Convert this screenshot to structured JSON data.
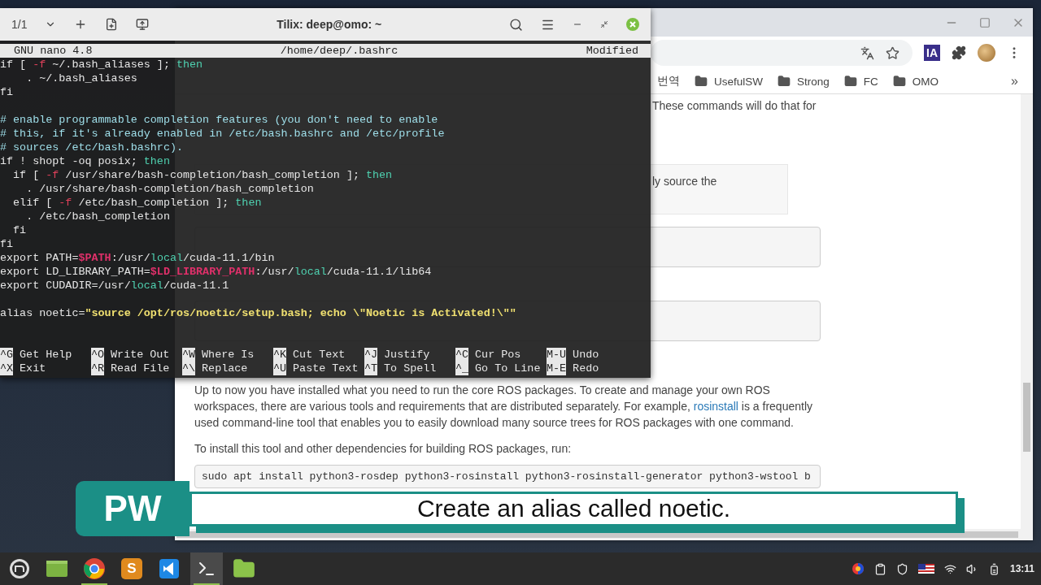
{
  "terminal": {
    "tab_counter": "1/1",
    "title": "Tilix: deep@omo: ~",
    "editor": {
      "app": "GNU nano 4.8",
      "file": "/home/deep/.bashrc",
      "status": "Modified"
    },
    "lines": [
      {
        "kind": "code",
        "segments": [
          {
            "kind": "plain",
            "text": "if [ "
          },
          {
            "kind": "option",
            "text": "-f"
          },
          {
            "kind": "plain",
            "text": " ~/.bash_aliases ]; "
          },
          {
            "kind": "keyword",
            "text": "then"
          }
        ]
      },
      {
        "segments": [
          {
            "kind": "plain",
            "text": "    . ~/.bash_aliases"
          }
        ]
      },
      {
        "segments": [
          {
            "kind": "plain",
            "text": "fi"
          }
        ]
      },
      {
        "kind": "blank"
      },
      {
        "segments": [
          {
            "kind": "comment",
            "text": "# enable programmable completion features (you don't need to enable"
          }
        ]
      },
      {
        "segments": [
          {
            "kind": "comment",
            "text": "# this, if it's already enabled in /etc/bash.bashrc and /etc/profile"
          }
        ]
      },
      {
        "segments": [
          {
            "kind": "comment",
            "text": "# sources /etc/bash.bashrc)."
          }
        ]
      },
      {
        "segments": [
          {
            "kind": "plain",
            "text": "if ! shopt -oq posix; "
          },
          {
            "kind": "keyword",
            "text": "then"
          }
        ]
      },
      {
        "segments": [
          {
            "kind": "plain",
            "text": "  if [ "
          },
          {
            "kind": "option",
            "text": "-f"
          },
          {
            "kind": "plain",
            "text": " /usr/share/bash-completion/bash_completion ]; "
          },
          {
            "kind": "keyword",
            "text": "then"
          }
        ]
      },
      {
        "segments": [
          {
            "kind": "plain",
            "text": "    . /usr/share/bash-completion/bash_completion"
          }
        ]
      },
      {
        "segments": [
          {
            "kind": "plain",
            "text": "  elif [ "
          },
          {
            "kind": "option",
            "text": "-f"
          },
          {
            "kind": "plain",
            "text": " /etc/bash_completion ]; "
          },
          {
            "kind": "keyword",
            "text": "then"
          }
        ]
      },
      {
        "segments": [
          {
            "kind": "plain",
            "text": "    . /etc/bash_completion"
          }
        ]
      },
      {
        "segments": [
          {
            "kind": "plain",
            "text": "  fi"
          }
        ]
      },
      {
        "segments": [
          {
            "kind": "plain",
            "text": "fi"
          }
        ]
      },
      {
        "segments": [
          {
            "kind": "plain",
            "text": "export PATH="
          },
          {
            "kind": "variable",
            "text": "$PATH"
          },
          {
            "kind": "plain",
            "text": ":/usr/"
          },
          {
            "kind": "keyword",
            "text": "local"
          },
          {
            "kind": "plain",
            "text": "/cuda-11.1/bin"
          }
        ]
      },
      {
        "segments": [
          {
            "kind": "plain",
            "text": "export LD_LIBRARY_PATH="
          },
          {
            "kind": "variable",
            "text": "$LD_LIBRARY_PATH"
          },
          {
            "kind": "plain",
            "text": ":/usr/"
          },
          {
            "kind": "keyword",
            "text": "local"
          },
          {
            "kind": "plain",
            "text": "/cuda-11.1/lib64"
          }
        ]
      },
      {
        "segments": [
          {
            "kind": "plain",
            "text": "export CUDADIR=/usr/"
          },
          {
            "kind": "keyword",
            "text": "local"
          },
          {
            "kind": "plain",
            "text": "/cuda-11.1"
          }
        ]
      },
      {
        "kind": "blank"
      },
      {
        "segments": [
          {
            "kind": "plain",
            "text": "alias noetic="
          },
          {
            "kind": "string",
            "text": "\"source /opt/ros/noetic/setup.bash; echo \\\"Noetic is Activated!\\\"\""
          }
        ]
      }
    ],
    "shortcuts": [
      [
        {
          "key": "^G",
          "label": "Get Help"
        },
        {
          "key": "^O",
          "label": "Write Out"
        },
        {
          "key": "^W",
          "label": "Where Is"
        },
        {
          "key": "^K",
          "label": "Cut Text"
        },
        {
          "key": "^J",
          "label": "Justify"
        },
        {
          "key": "^C",
          "label": "Cur Pos"
        },
        {
          "key": "M-U",
          "label": "Undo"
        }
      ],
      [
        {
          "key": "^X",
          "label": "Exit"
        },
        {
          "key": "^R",
          "label": "Read File"
        },
        {
          "key": "^\\",
          "label": "Replace"
        },
        {
          "key": "^U",
          "label": "Paste Text"
        },
        {
          "key": "^T",
          "label": "To Spell"
        },
        {
          "key": "^_",
          "label": "Go To Line"
        },
        {
          "key": "M-E",
          "label": "Redo"
        }
      ]
    ]
  },
  "browser": {
    "extension_badge": "IA",
    "bookmarks": [
      {
        "kind": "text",
        "label": "번역"
      },
      {
        "kind": "folder",
        "label": "UsefulSW"
      },
      {
        "kind": "folder",
        "label": "Strong"
      },
      {
        "kind": "folder",
        "label": "FC"
      },
      {
        "kind": "folder",
        "label": "OMO"
      }
    ],
    "more_bookmarks": "»",
    "content": {
      "intro_tail": "These commands will do that for",
      "note_tail": "ly source the",
      "paragraph": "Up to now you have installed what you need to run the core ROS packages. To create and manage your own ROS workspaces, there are various tools and requirements that are distributed separately. For example, ",
      "link": "rosinstall",
      "paragraph_end": " is a frequently used command-line tool that enables you to easily download many source trees for ROS packages with one command.",
      "install_text": "To install this tool and other dependencies for building ROS packages, run:",
      "install_command": "sudo apt install python3-rosdep python3-rosinstall python3-rosinstall-generator python3-wstool b"
    }
  },
  "caption": {
    "badge": "PW",
    "text": "Create an alias called noetic."
  },
  "taskbar": {
    "apps": [
      {
        "kind": "menu",
        "selected": false,
        "running": false
      },
      {
        "kind": "files",
        "selected": false,
        "running": false
      },
      {
        "kind": "chrome",
        "selected": false,
        "running": true
      },
      {
        "kind": "sublime",
        "glyph": "S",
        "selected": false,
        "running": false
      },
      {
        "kind": "vscode",
        "selected": false,
        "running": false
      },
      {
        "kind": "terminal",
        "selected": true,
        "running": true
      },
      {
        "kind": "folder",
        "selected": false,
        "running": false
      }
    ],
    "clock": "13:11"
  }
}
